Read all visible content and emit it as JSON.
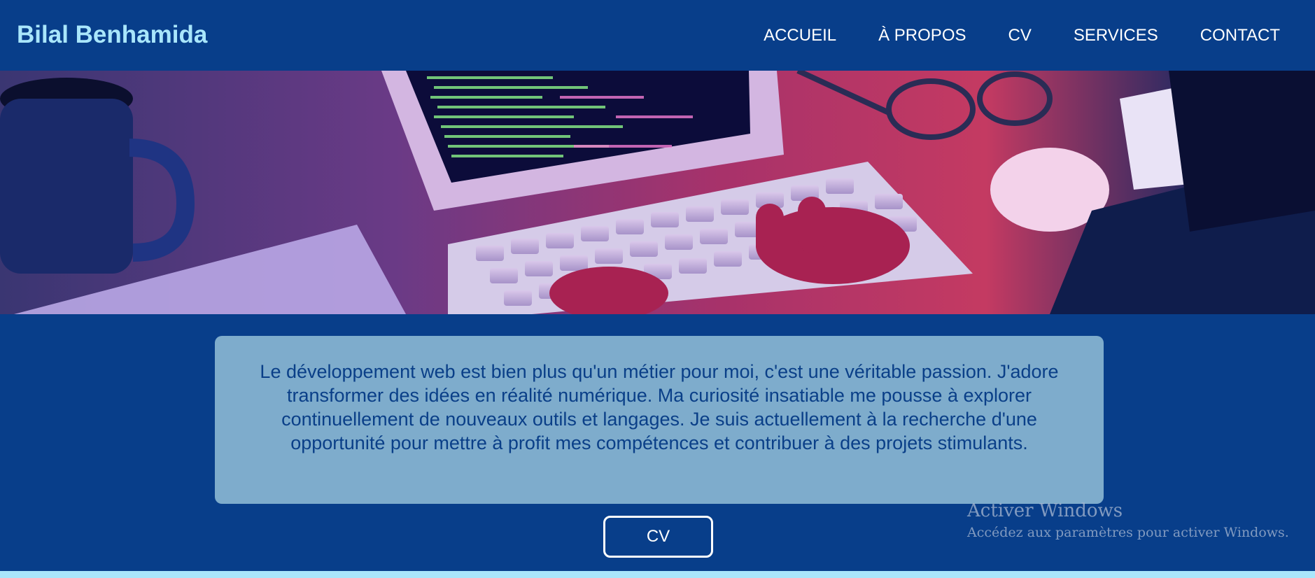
{
  "header": {
    "brand": "Bilal Benhamida",
    "nav": [
      {
        "label": "ACCUEIL"
      },
      {
        "label": "À PROPOS"
      },
      {
        "label": "CV"
      },
      {
        "label": "SERVICES"
      },
      {
        "label": "CONTACT"
      }
    ]
  },
  "hero": {
    "image_description": "desk-workspace-photo"
  },
  "about": {
    "text": "Le développement web est bien plus qu'un métier pour moi, c'est une véritable passion. J'adore transformer des idées en réalité numérique. Ma curiosité insatiable me pousse à explorer continuellement de nouveaux outils et langages. Je suis actuellement à la recherche d'une opportunité pour mettre à profit mes compétences et contribuer à des projets stimulants."
  },
  "cv_button": {
    "label": "CV"
  },
  "watermark": {
    "title": "Activer Windows",
    "subtitle": "Accédez aux paramètres pour activer Windows."
  },
  "colors": {
    "background": "#083e8a",
    "brand": "#a9e6fb",
    "about_box": "#7eaccc",
    "about_text": "#0a3f88"
  }
}
